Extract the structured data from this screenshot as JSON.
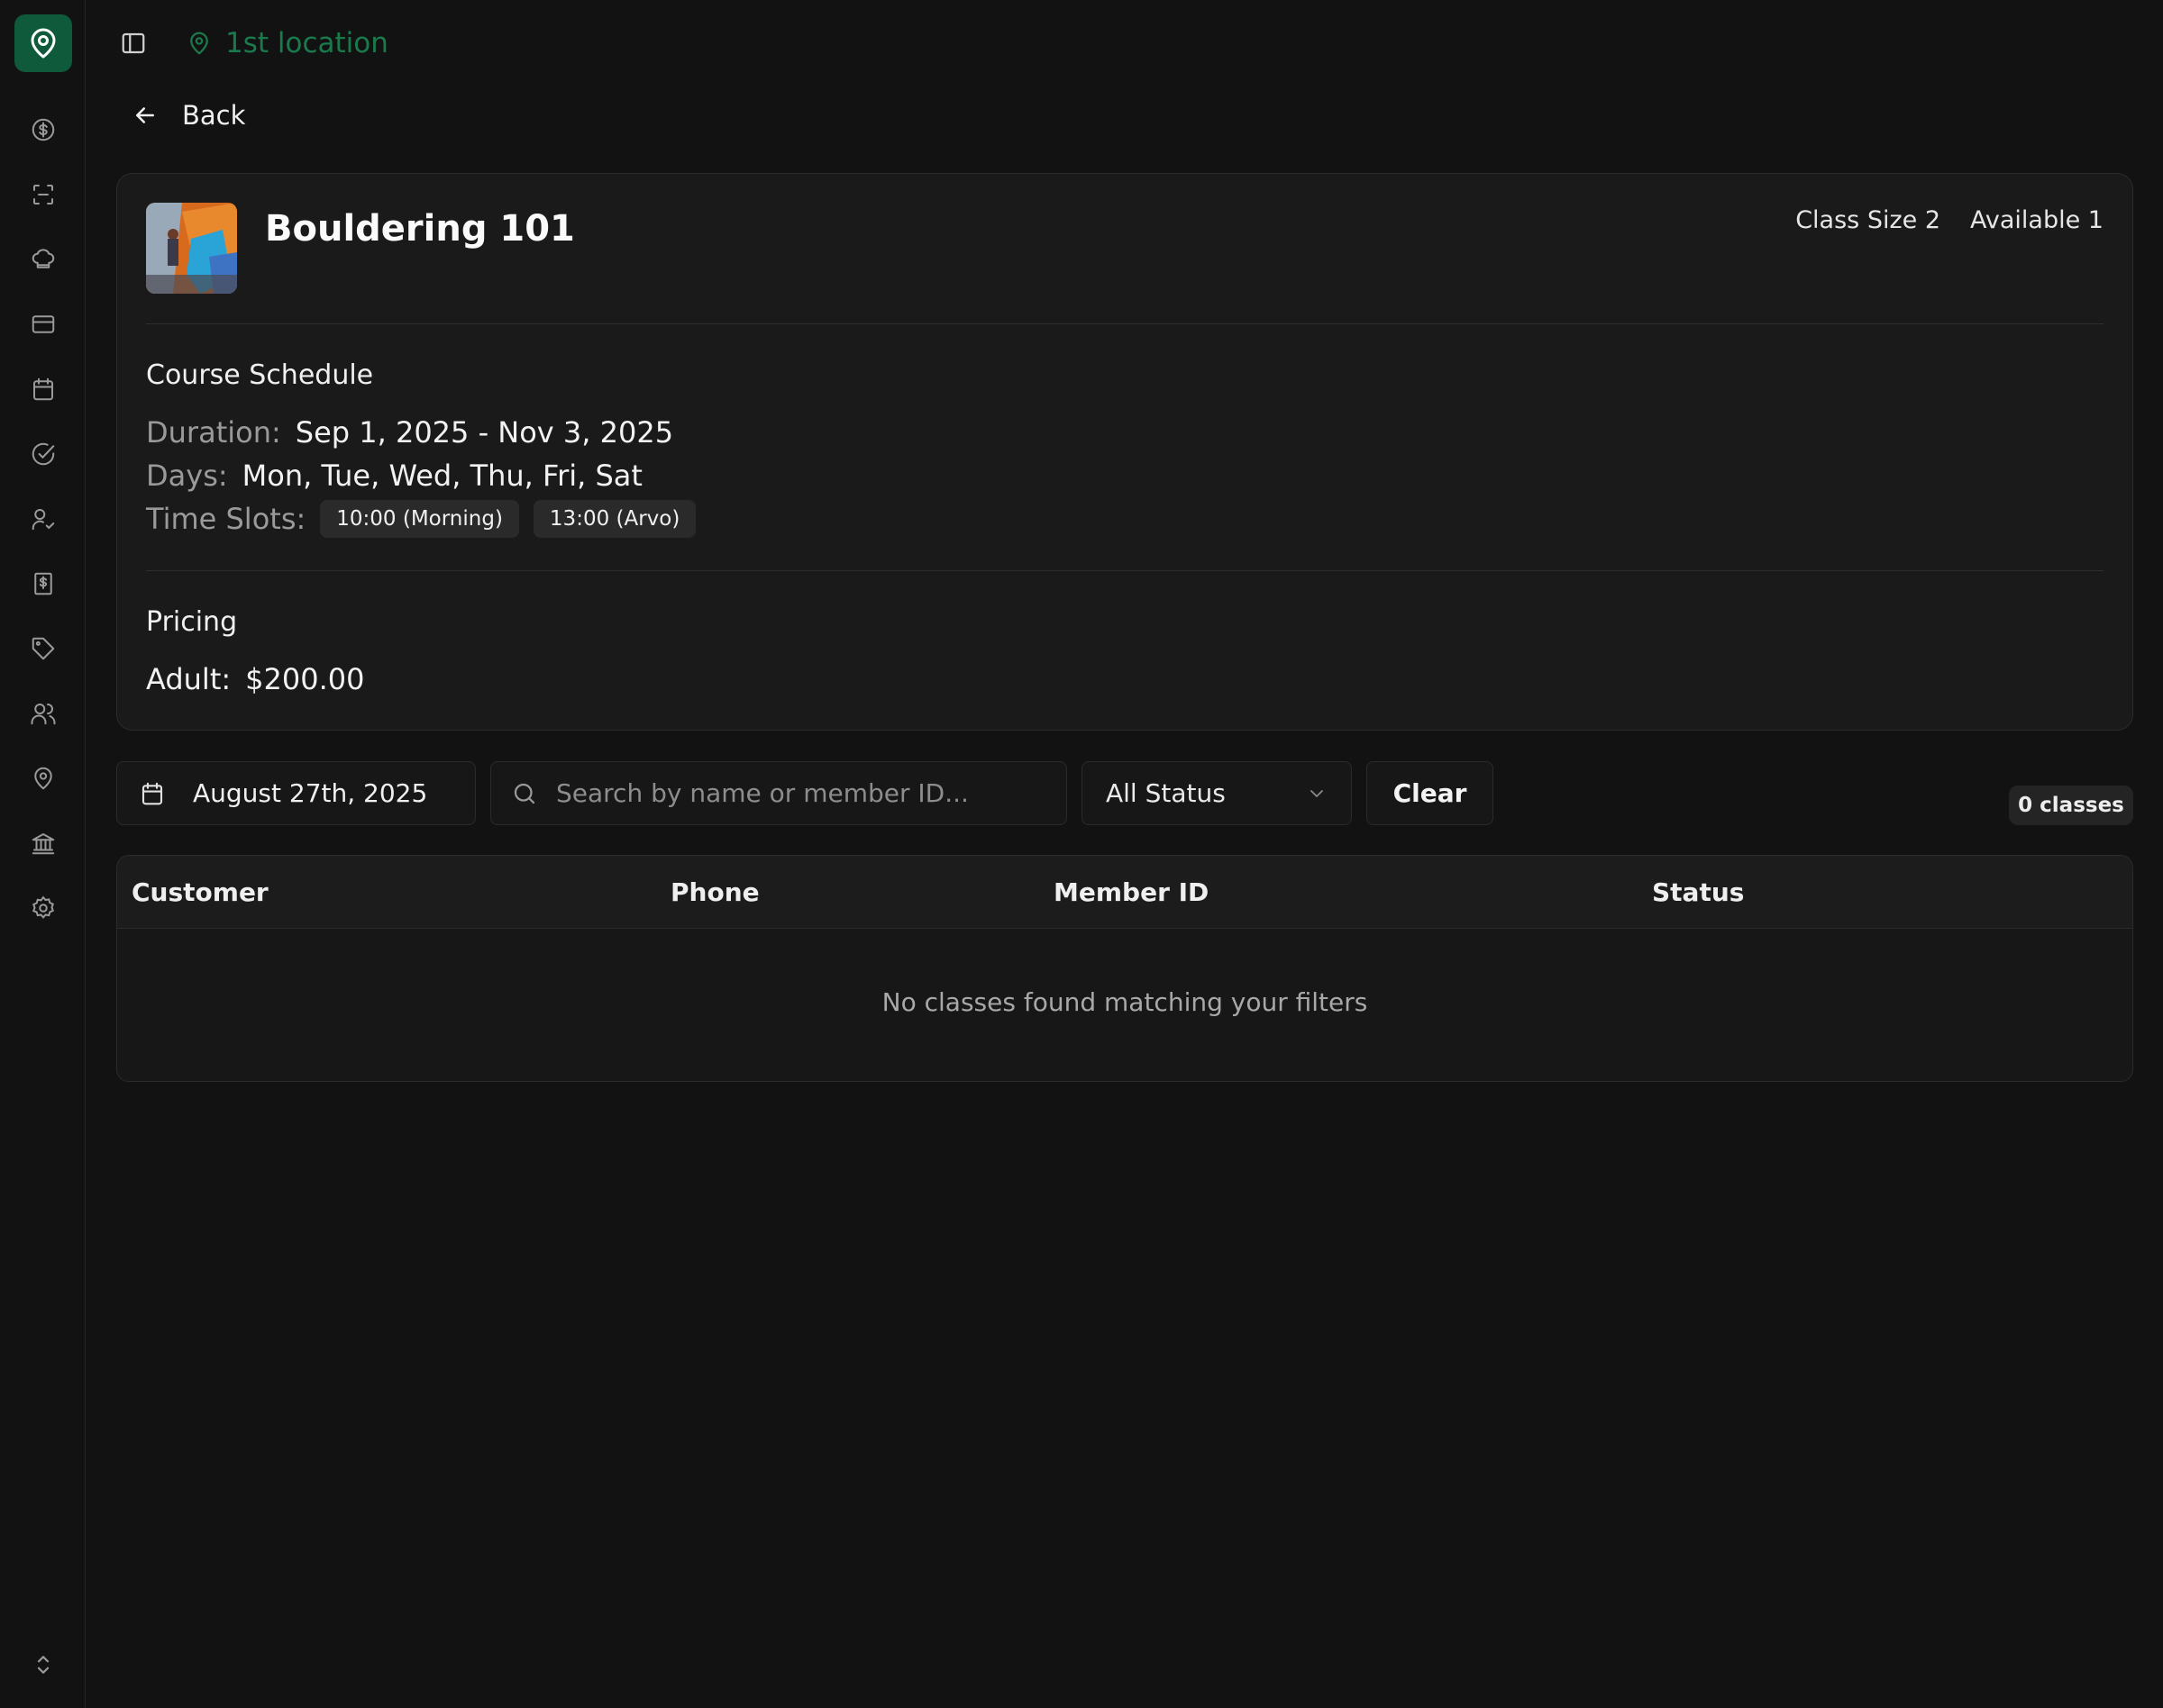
{
  "sidebar": {
    "items": [
      {
        "icon": "dollar-circle-icon"
      },
      {
        "icon": "scan-icon"
      },
      {
        "icon": "chef-hat-icon"
      },
      {
        "icon": "credit-card-icon"
      },
      {
        "icon": "calendar-icon"
      },
      {
        "icon": "check-circle-icon"
      },
      {
        "icon": "user-check-icon"
      },
      {
        "icon": "receipt-dollar-icon"
      },
      {
        "icon": "tag-icon"
      },
      {
        "icon": "users-icon"
      },
      {
        "icon": "map-pin-icon"
      },
      {
        "icon": "bank-icon"
      },
      {
        "icon": "settings-icon"
      }
    ],
    "accent": "#0f5a3a"
  },
  "header": {
    "location": "1st location",
    "location_color": "#1a7a4c"
  },
  "back_label": "Back",
  "course": {
    "title": "Bouldering 101",
    "class_size": "Class Size 2",
    "available": "Available 1",
    "schedule_title": "Course Schedule",
    "duration_label": "Duration:",
    "duration_value": "Sep 1, 2025 - Nov 3, 2025",
    "days_label": "Days:",
    "days_value": "Mon, Tue, Wed, Thu, Fri, Sat",
    "timeslots_label": "Time Slots:",
    "timeslots": [
      "10:00 (Morning)",
      "13:00 (Arvo)"
    ],
    "pricing_title": "Pricing",
    "adult_label": "Adult:",
    "adult_value": "$200.00"
  },
  "filters": {
    "date": "August 27th, 2025",
    "search_placeholder": "Search by name or member ID...",
    "status": "All Status",
    "clear_label": "Clear",
    "count": "0 classes"
  },
  "table": {
    "columns": [
      "Customer",
      "Phone",
      "Member ID",
      "Status"
    ],
    "empty_message": "No classes found matching your filters"
  }
}
